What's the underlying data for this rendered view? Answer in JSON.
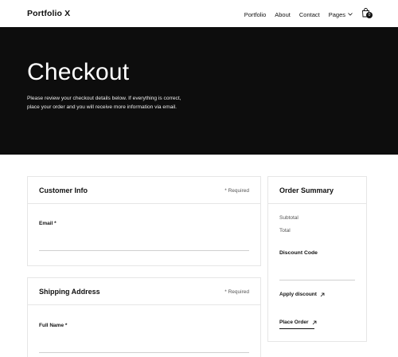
{
  "nav": {
    "brand": "Portfolio X",
    "links": [
      "Portfolio",
      "About",
      "Contact",
      "Pages"
    ],
    "cart_count": "0"
  },
  "hero": {
    "title": "Checkout",
    "description": "Please review your checkout details below. If everything is correct, place your order and you will receive more information via email."
  },
  "customer_info": {
    "title": "Customer Info",
    "required": "* Required",
    "email_label": "Email *"
  },
  "shipping": {
    "title": "Shipping Address",
    "required": "* Required",
    "fullname_label": "Full Name *"
  },
  "summary": {
    "title": "Order Summary",
    "subtotal": "Subtotal",
    "total": "Total",
    "discount_label": "Discount Code",
    "apply_label": "Apply discount",
    "place_label": "Place Order"
  },
  "colors": {
    "hero_bg": "#0d0d0d",
    "border": "#e6e6e6",
    "text": "#111111"
  }
}
